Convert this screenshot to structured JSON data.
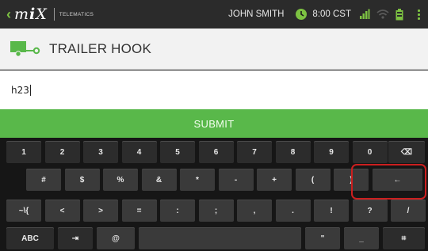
{
  "status": {
    "logo_text": "mix",
    "logo_sub": "TELEMATICS",
    "user": "JOHN SMITH",
    "time": "8:00 CST",
    "icons": [
      "clock-icon",
      "signal-icon",
      "wifi-icon",
      "battery-icon",
      "overflow-menu-icon"
    ],
    "accent_color": "#7dc242"
  },
  "title": {
    "icon": "trailer-icon",
    "text": "TRAILER HOOK"
  },
  "input": {
    "value": "h23"
  },
  "submit": {
    "label": "SUBMIT",
    "color": "#59b84a"
  },
  "keyboard": {
    "row1": [
      "1",
      "2",
      "3",
      "4",
      "5",
      "6",
      "7",
      "8",
      "9",
      "0"
    ],
    "row1_backspace": "⌫",
    "row2": [
      "#",
      "$",
      "%",
      "&",
      "*",
      "-",
      "+",
      "(",
      ")"
    ],
    "row2_enter": "←",
    "row3": [
      "~\\{",
      "<",
      ">",
      "=",
      ":",
      ";",
      ",",
      ".",
      "!",
      "?",
      "/"
    ],
    "row4": {
      "abc": "ABC",
      "tab": "⇥",
      "at": "@",
      "quote": "\"",
      "underscore": "_",
      "settings": "⌗"
    }
  }
}
